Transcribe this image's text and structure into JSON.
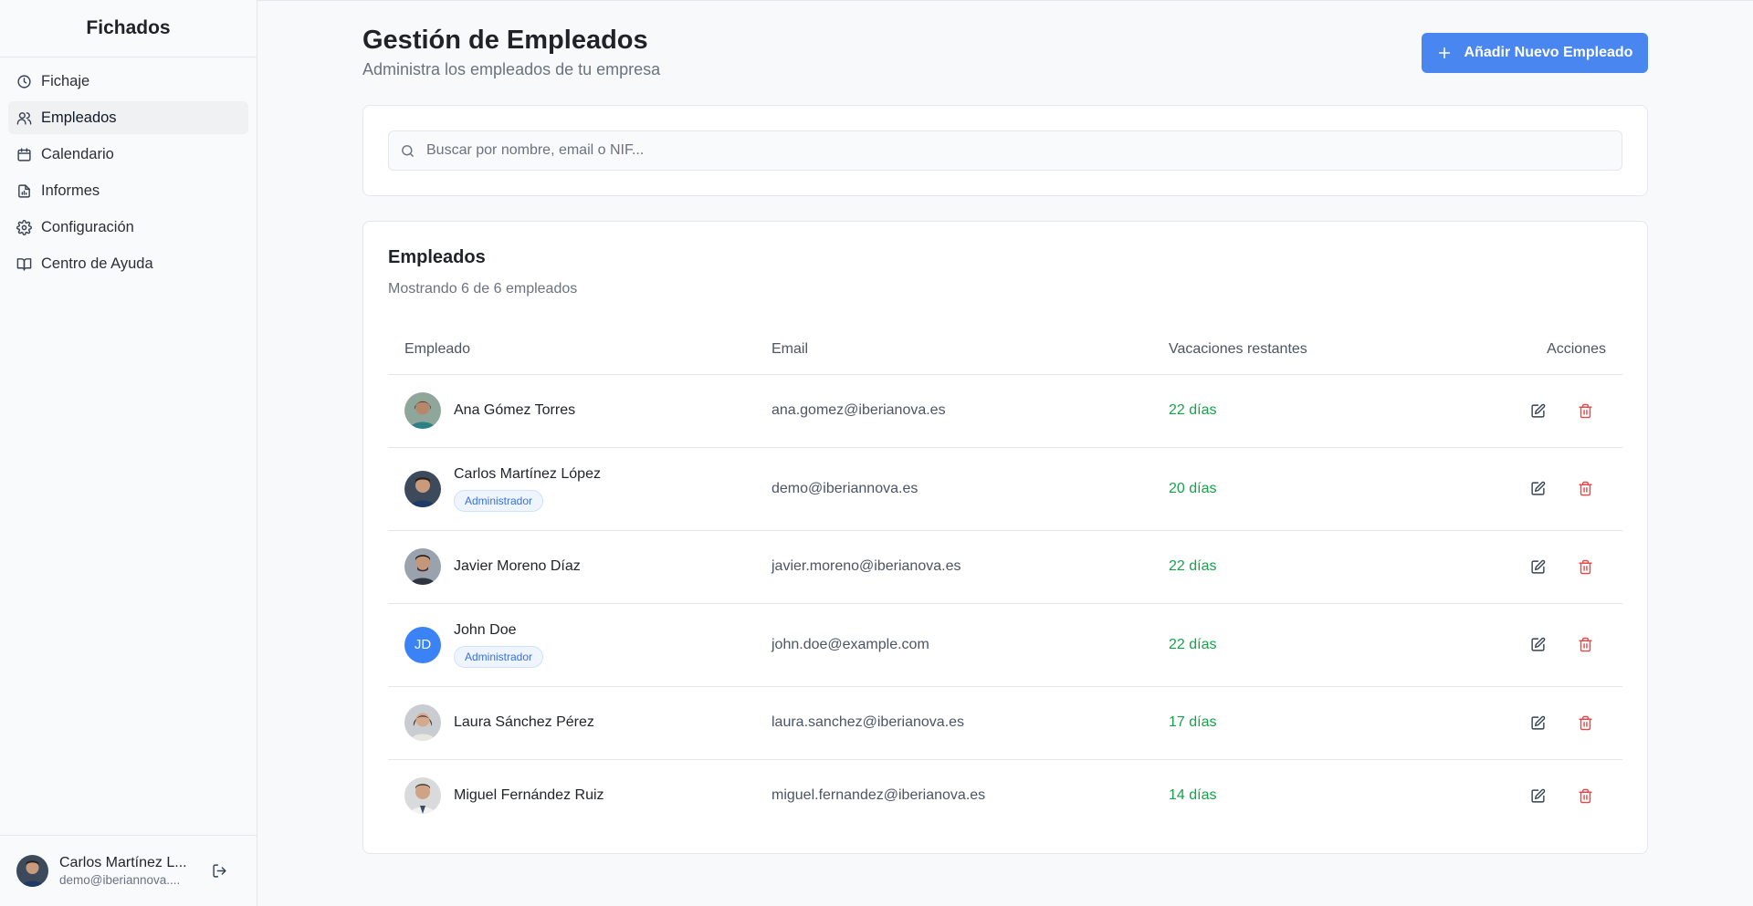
{
  "app": {
    "brand": "Fichados"
  },
  "sidebar": {
    "items": [
      {
        "label": "Fichaje",
        "icon": "clock-icon",
        "active": false
      },
      {
        "label": "Empleados",
        "icon": "users-icon",
        "active": true
      },
      {
        "label": "Calendario",
        "icon": "calendar-icon",
        "active": false
      },
      {
        "label": "Informes",
        "icon": "report-icon",
        "active": false
      },
      {
        "label": "Configuración",
        "icon": "gear-icon",
        "active": false
      },
      {
        "label": "Centro de Ayuda",
        "icon": "book-icon",
        "active": false
      }
    ],
    "user": {
      "name": "Carlos Martínez L...",
      "email": "demo@iberiannova...."
    }
  },
  "header": {
    "title": "Gestión de Empleados",
    "subtitle": "Administra los empleados de tu empresa",
    "add_button": "Añadir Nuevo Empleado"
  },
  "search": {
    "placeholder": "Buscar por nombre, email o NIF..."
  },
  "employees": {
    "title": "Empleados",
    "summary": "Mostrando 6 de 6 empleados",
    "columns": [
      "Empleado",
      "Email",
      "Vacaciones restantes",
      "Acciones"
    ],
    "rows": [
      {
        "name": "Ana Gómez Torres",
        "email": "ana.gomez@iberianova.es",
        "vacation": "22 días",
        "badge": "",
        "avatar": "photo"
      },
      {
        "name": "Carlos Martínez López",
        "email": "demo@iberiannova.es",
        "vacation": "20 días",
        "badge": "Administrador",
        "avatar": "photo"
      },
      {
        "name": "Javier Moreno Díaz",
        "email": "javier.moreno@iberianova.es",
        "vacation": "22 días",
        "badge": "",
        "avatar": "photo"
      },
      {
        "name": "John Doe",
        "email": "john.doe@example.com",
        "vacation": "22 días",
        "badge": "Administrador",
        "avatar": "JD"
      },
      {
        "name": "Laura Sánchez Pérez",
        "email": "laura.sanchez@iberianova.es",
        "vacation": "17 días",
        "badge": "",
        "avatar": "photo"
      },
      {
        "name": "Miguel Fernández Ruiz",
        "email": "miguel.fernandez@iberianova.es",
        "vacation": "14 días",
        "badge": "",
        "avatar": "photo"
      }
    ]
  },
  "colors": {
    "accent": "#4a86ef",
    "success": "#16a34a",
    "danger": "#ef4444"
  }
}
